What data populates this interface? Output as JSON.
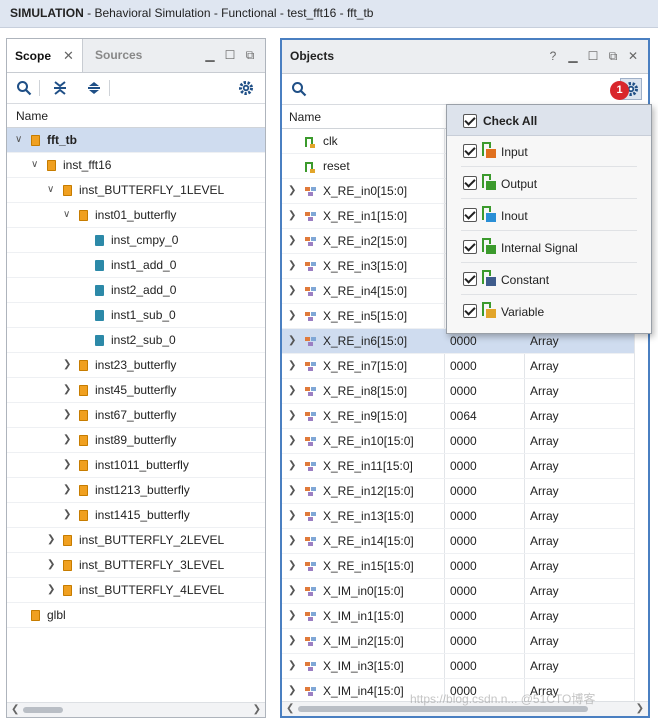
{
  "window": {
    "title_prefix": "SIMULATION",
    "title_rest": " - Behavioral Simulation - Functional - test_fft16 - fft_tb"
  },
  "scope_panel": {
    "tab_active": "Scope",
    "tab_inactive": "Sources",
    "col_name": "Name",
    "items": [
      {
        "label": "fft_tb",
        "kind": "module",
        "level": 0,
        "expand": "open",
        "bold": true,
        "selected": true
      },
      {
        "label": "inst_fft16",
        "kind": "module",
        "level": 1,
        "expand": "open"
      },
      {
        "label": "inst_BUTTERFLY_1LEVEL",
        "kind": "module",
        "level": 2,
        "expand": "open"
      },
      {
        "label": "inst01_butterfly",
        "kind": "module",
        "level": 3,
        "expand": "open"
      },
      {
        "label": "inst_cmpy_0",
        "kind": "prim",
        "level": 4,
        "expand": "none"
      },
      {
        "label": "inst1_add_0",
        "kind": "prim",
        "level": 4,
        "expand": "none"
      },
      {
        "label": "inst2_add_0",
        "kind": "prim",
        "level": 4,
        "expand": "none"
      },
      {
        "label": "inst1_sub_0",
        "kind": "prim",
        "level": 4,
        "expand": "none"
      },
      {
        "label": "inst2_sub_0",
        "kind": "prim",
        "level": 4,
        "expand": "none"
      },
      {
        "label": "inst23_butterfly",
        "kind": "module",
        "level": 3,
        "expand": "closed"
      },
      {
        "label": "inst45_butterfly",
        "kind": "module",
        "level": 3,
        "expand": "closed"
      },
      {
        "label": "inst67_butterfly",
        "kind": "module",
        "level": 3,
        "expand": "closed"
      },
      {
        "label": "inst89_butterfly",
        "kind": "module",
        "level": 3,
        "expand": "closed"
      },
      {
        "label": "inst1011_butterfly",
        "kind": "module",
        "level": 3,
        "expand": "closed"
      },
      {
        "label": "inst1213_butterfly",
        "kind": "module",
        "level": 3,
        "expand": "closed"
      },
      {
        "label": "inst1415_butterfly",
        "kind": "module",
        "level": 3,
        "expand": "closed"
      },
      {
        "label": "inst_BUTTERFLY_2LEVEL",
        "kind": "module",
        "level": 2,
        "expand": "closed"
      },
      {
        "label": "inst_BUTTERFLY_3LEVEL",
        "kind": "module",
        "level": 2,
        "expand": "closed"
      },
      {
        "label": "inst_BUTTERFLY_4LEVEL",
        "kind": "module",
        "level": 2,
        "expand": "closed"
      },
      {
        "label": "glbl",
        "kind": "module",
        "level": 0,
        "expand": "none"
      }
    ]
  },
  "objects_panel": {
    "title": "Objects",
    "help": "?",
    "col_name": "Name",
    "rows": [
      {
        "name": "clk",
        "value": "",
        "type": "",
        "kind": "bit",
        "expand": false
      },
      {
        "name": "reset",
        "value": "",
        "type": "",
        "kind": "bit",
        "expand": false
      },
      {
        "name": "X_RE_in0[15:0]",
        "value": "",
        "type": "",
        "kind": "array",
        "expand": true
      },
      {
        "name": "X_RE_in1[15:0]",
        "value": "",
        "type": "",
        "kind": "array",
        "expand": true
      },
      {
        "name": "X_RE_in2[15:0]",
        "value": "",
        "type": "",
        "kind": "array",
        "expand": true
      },
      {
        "name": "X_RE_in3[15:0]",
        "value": "",
        "type": "",
        "kind": "array",
        "expand": true
      },
      {
        "name": "X_RE_in4[15:0]",
        "value": "",
        "type": "",
        "kind": "array",
        "expand": true
      },
      {
        "name": "X_RE_in5[15:0]",
        "value": "",
        "type": "",
        "kind": "array",
        "expand": true
      },
      {
        "name": "X_RE_in6[15:0]",
        "value": "0000",
        "type": "Array",
        "kind": "array",
        "expand": true,
        "selected": true
      },
      {
        "name": "X_RE_in7[15:0]",
        "value": "0000",
        "type": "Array",
        "kind": "array",
        "expand": true
      },
      {
        "name": "X_RE_in8[15:0]",
        "value": "0000",
        "type": "Array",
        "kind": "array",
        "expand": true
      },
      {
        "name": "X_RE_in9[15:0]",
        "value": "0064",
        "type": "Array",
        "kind": "array",
        "expand": true
      },
      {
        "name": "X_RE_in10[15:0]",
        "value": "0000",
        "type": "Array",
        "kind": "array",
        "expand": true
      },
      {
        "name": "X_RE_in11[15:0]",
        "value": "0000",
        "type": "Array",
        "kind": "array",
        "expand": true
      },
      {
        "name": "X_RE_in12[15:0]",
        "value": "0000",
        "type": "Array",
        "kind": "array",
        "expand": true
      },
      {
        "name": "X_RE_in13[15:0]",
        "value": "0000",
        "type": "Array",
        "kind": "array",
        "expand": true
      },
      {
        "name": "X_RE_in14[15:0]",
        "value": "0000",
        "type": "Array",
        "kind": "array",
        "expand": true
      },
      {
        "name": "X_RE_in15[15:0]",
        "value": "0000",
        "type": "Array",
        "kind": "array",
        "expand": true
      },
      {
        "name": "X_IM_in0[15:0]",
        "value": "0000",
        "type": "Array",
        "kind": "array",
        "expand": true
      },
      {
        "name": "X_IM_in1[15:0]",
        "value": "0000",
        "type": "Array",
        "kind": "array",
        "expand": true
      },
      {
        "name": "X_IM_in2[15:0]",
        "value": "0000",
        "type": "Array",
        "kind": "array",
        "expand": true
      },
      {
        "name": "X_IM_in3[15:0]",
        "value": "0000",
        "type": "Array",
        "kind": "array",
        "expand": true
      },
      {
        "name": "X_IM_in4[15:0]",
        "value": "0000",
        "type": "Array",
        "kind": "array",
        "expand": true
      }
    ]
  },
  "filter_popup": {
    "check_all": "Check All",
    "items": [
      {
        "label": "Input",
        "icon": "input-port-icon",
        "color": "#e0701e"
      },
      {
        "label": "Output",
        "icon": "output-port-icon",
        "color": "#3b9a2c"
      },
      {
        "label": "Inout",
        "icon": "inout-port-icon",
        "color": "#2a8fd6"
      },
      {
        "label": "Internal Signal",
        "icon": "internal-signal-icon",
        "color": "#3b9a2c"
      },
      {
        "label": "Constant",
        "icon": "constant-icon",
        "color": "#3f5c8c"
      },
      {
        "label": "Variable",
        "icon": "variable-icon",
        "color": "#e2a52a"
      }
    ]
  },
  "settings_badge": "1",
  "watermark": "https://blog.csdn.n... @51CTO博客"
}
